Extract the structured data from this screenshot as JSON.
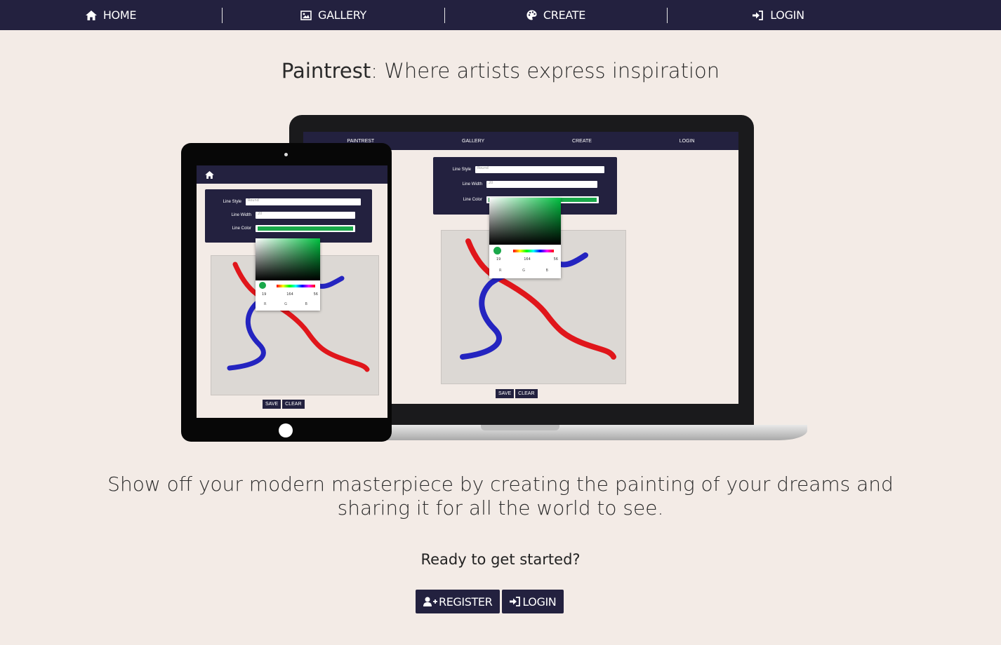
{
  "nav": {
    "items": [
      {
        "label": "HOME",
        "icon": "home-icon"
      },
      {
        "label": "GALLERY",
        "icon": "image-icon"
      },
      {
        "label": "CREATE",
        "icon": "palette-icon"
      },
      {
        "label": "LOGIN",
        "icon": "login-icon"
      }
    ]
  },
  "hero": {
    "brand": "Paintrest",
    "subtitle": ": Where artists express inspiration"
  },
  "illustration": {
    "laptop_nav": [
      "PAINTREST",
      "GALLERY",
      "CREATE",
      "LOGIN"
    ],
    "labels": {
      "line_style": "Line Style",
      "line_width": "Line Width",
      "line_color": "Line Color"
    },
    "line_style_value": "Round",
    "line_width_value": "20",
    "rgb": [
      "19",
      "164",
      "56"
    ],
    "rgb_labels": [
      "R",
      "G",
      "B"
    ],
    "save": "SAVE",
    "clear": "CLEAR"
  },
  "tagline": "Show off your modern masterpiece by creating the painting of your dreams and sharing it for all the world to see.",
  "ready": "Ready to get started?",
  "buttons": {
    "register": "REGISTER",
    "login": "LOGIN"
  },
  "colors": {
    "nav_bg": "#23213f",
    "page_bg": "#f3ebe6",
    "red_stroke": "#e0161b",
    "blue_stroke": "#2424c0",
    "picker_green": "#1aa84a"
  }
}
